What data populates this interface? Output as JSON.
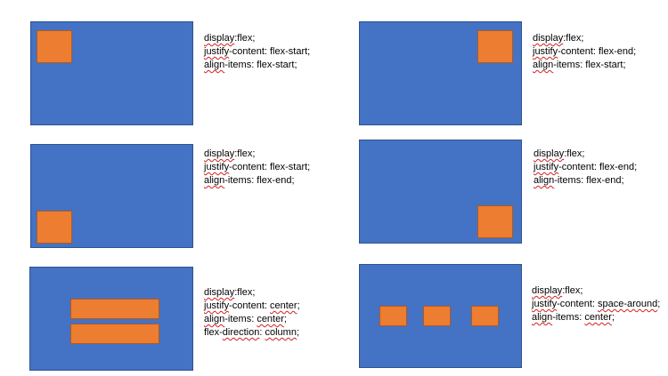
{
  "examples": [
    {
      "lines": [
        {
          "prop": "display",
          "rest": ":flex;"
        },
        {
          "prop": "justify",
          "rest": "-content: flex-start;"
        },
        {
          "prop": "align",
          "rest": "-items: flex-start;"
        }
      ]
    },
    {
      "lines": [
        {
          "prop": "display",
          "rest": ":flex;"
        },
        {
          "prop": "justify",
          "rest": "-content: flex-end;"
        },
        {
          "prop": "align",
          "rest": "-items: flex-start;"
        }
      ]
    },
    {
      "lines": [
        {
          "prop": "display",
          "rest": ":flex;"
        },
        {
          "prop": "justify",
          "rest": "-content: flex-start;"
        },
        {
          "prop": "align",
          "rest": "-items: flex-end;"
        }
      ]
    },
    {
      "lines": [
        {
          "prop": "display",
          "rest": ":flex;"
        },
        {
          "prop": "justify",
          "rest": "-content: flex-end;"
        },
        {
          "prop": "align",
          "rest": "-items: flex-end;"
        }
      ]
    },
    {
      "lines": [
        {
          "prop": "display",
          "rest": ":flex;"
        },
        {
          "prop": "justify",
          "rest": "-content: ",
          "value": "center",
          "end": ";"
        },
        {
          "prop": "align",
          "rest": "-items: ",
          "value": "center",
          "end": ";"
        },
        {
          "prop": "flex-",
          "prop2": "direction",
          "rest": ": ",
          "value": "column",
          "end": ";"
        }
      ]
    },
    {
      "lines": [
        {
          "prop": "display",
          "rest": ":flex;"
        },
        {
          "prop": "justify",
          "rest": "-content: ",
          "value": "space-around",
          "end": ";"
        },
        {
          "prop": "align",
          "rest": "-items: ",
          "value": "center",
          "end": ";"
        }
      ]
    }
  ],
  "colors": {
    "container": "#4472c4",
    "item": "#ed7d31",
    "spellcheck": "#d21f1f"
  }
}
